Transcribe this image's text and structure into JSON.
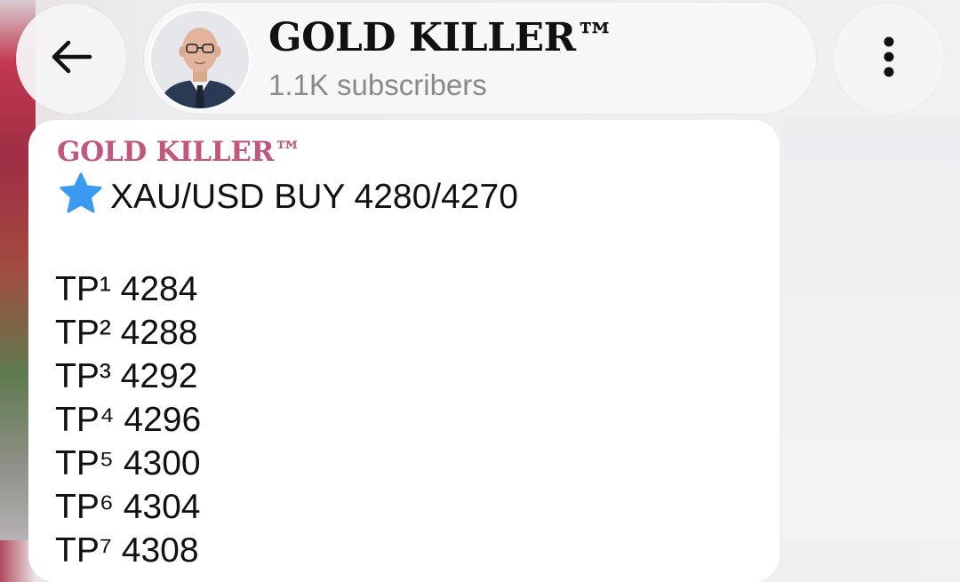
{
  "header": {
    "back_icon": "arrow-left-icon",
    "menu_icon": "more-vertical-icon",
    "channel_title": "GOLD KILLER™",
    "subscribers": "1.1K subscribers"
  },
  "message": {
    "sender": "GOLD KILLER™",
    "signal_icon": "star-icon",
    "signal_text": "XAU/USD BUY 4280/4270",
    "take_profits": [
      "TP¹ 4284",
      "TP² 4288",
      "TP³ 4292",
      "TP⁴ 4296",
      "TP⁵ 4300",
      "TP⁶ 4304",
      "TP⁷ 4308"
    ]
  },
  "colors": {
    "sender": "#c2567b",
    "star": "#3a9bf0"
  }
}
